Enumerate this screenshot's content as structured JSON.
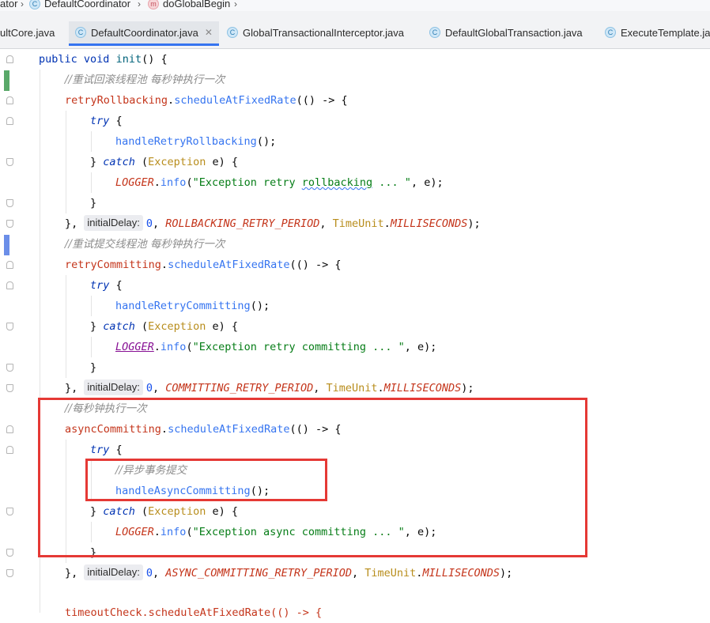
{
  "breadcrumb": [
    {
      "label": "ator",
      "icon": "none"
    },
    {
      "label": "DefaultCoordinator",
      "icon": "class-icon"
    },
    {
      "label": "doGlobalBegin",
      "icon": "method-icon"
    }
  ],
  "tabs": [
    {
      "label": "ultCore.java",
      "icon": "none",
      "closable": false
    },
    {
      "label": "DefaultCoordinator.java",
      "icon": "class-icon",
      "closable": true,
      "active": true
    },
    {
      "label": "GlobalTransactionalInterceptor.java",
      "icon": "class-icon",
      "closable": false
    },
    {
      "label": "DefaultGlobalTransaction.java",
      "icon": "class-icon",
      "closable": false
    },
    {
      "label": "ExecuteTemplate.jav",
      "icon": "class-icon",
      "closable": false
    }
  ],
  "code": {
    "method_signature": {
      "kw1": "public",
      "kw2": "void",
      "name": "init",
      "rest": "() {"
    },
    "comment_rollback": "//重试回滚线程池 每秒钟执行一次",
    "rollback_field": "retryRollbacking",
    "schedule_method": "scheduleAtFixedRate",
    "lambda_open": "(() -> {",
    "try_kw": "try",
    "brace_open": " {",
    "rollback_call": "handleRetryRollbacking",
    "call_end": "();",
    "catch_close": "} ",
    "catch_kw": "catch",
    "catch_paren": " (",
    "exception_cls": "Exception",
    "catch_end": " e) {",
    "logger": "LOGGER",
    "info": "info",
    "str_rollback_a": "\"Exception retry ",
    "str_rollback_typo": "rollbacking",
    "str_rollback_b": " ... \"",
    "log_end": ", e);",
    "close_brace": "}",
    "lambda_close": "},",
    "inlay_hint": "initialDelay:",
    "delay_value": "0",
    "rollback_period": "ROLLBACKING_RETRY_PERIOD",
    "timeunit": "TimeUnit",
    "millis": "MILLISECONDS",
    "stmt_end": ");",
    "comment_commit": "//重试提交线程池 每秒钟执行一次",
    "commit_field": "retryCommitting",
    "commit_call": "handleRetryCommitting",
    "str_commit": "\"Exception retry committing ... \"",
    "commit_period": "COMMITTING_RETRY_PERIOD",
    "comment_async": "//每秒钟执行一次",
    "async_field": "asyncCommitting",
    "comment_async_inner": "//异步事务提交",
    "async_call": "handleAsyncCommitting",
    "str_async": "\"Exception async committing ... \"",
    "async_period": "ASYNC_COMMITTING_RETRY_PERIOD",
    "timeout_partial": "timeoutCheck.scheduleAtFixedRate(() -> {"
  },
  "colors": {
    "keyword": "#0033b3",
    "method": "#00627a",
    "field": "#c4351b",
    "class": "#b88d1c",
    "string": "#067d17",
    "number": "#1750eb",
    "comment": "#8c8c8c",
    "highlight_box": "#e53935",
    "tab_active_underline": "#3574f0",
    "change_marker_green": "#59a869",
    "change_marker_blue": "#6b8ee8"
  }
}
